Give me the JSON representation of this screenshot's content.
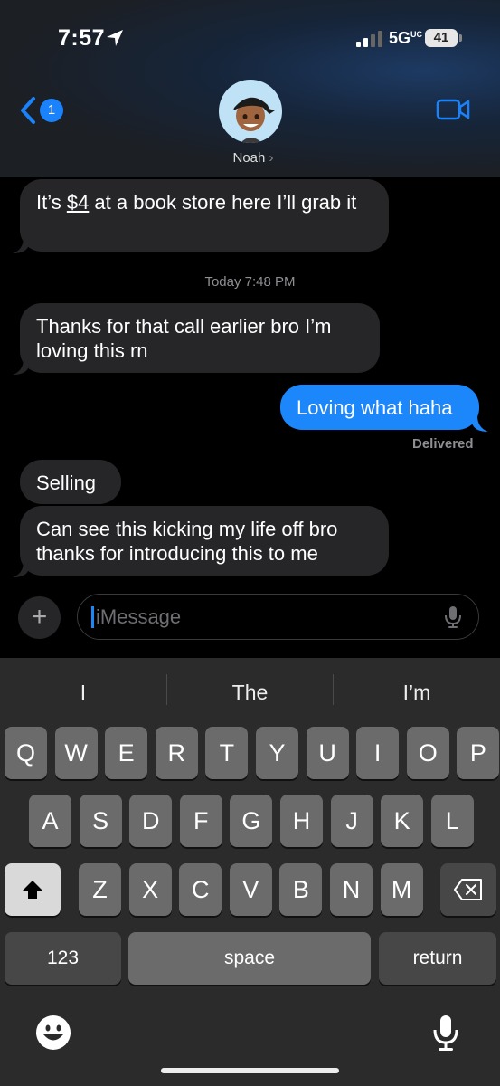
{
  "status_bar": {
    "time": "7:57",
    "network": "5G",
    "network_suffix": "UC",
    "battery": "41"
  },
  "header": {
    "back_badge": "1",
    "contact_name": "Noah",
    "name_chevron": "›"
  },
  "messages": [
    {
      "from": "them",
      "text_prefix": "It’s ",
      "text_link": "$4",
      "text_suffix": " at a book store here I’ll grab it"
    },
    {
      "from": "meta",
      "label": "Today",
      "time": "7:48 PM"
    },
    {
      "from": "them",
      "text": "Thanks for that call earlier bro I’m loving this rn"
    },
    {
      "from": "me",
      "text": "Loving what haha",
      "status": "Delivered"
    },
    {
      "from": "them",
      "text": "Selling"
    },
    {
      "from": "them",
      "text": "Can see this kicking my life off bro thanks for introducing this to me"
    }
  ],
  "composer": {
    "placeholder": "iMessage",
    "plus": "+"
  },
  "keyboard": {
    "suggestions": [
      "I",
      "The",
      "I’m"
    ],
    "row1": [
      "Q",
      "W",
      "E",
      "R",
      "T",
      "Y",
      "U",
      "I",
      "O",
      "P"
    ],
    "row2": [
      "A",
      "S",
      "D",
      "F",
      "G",
      "H",
      "J",
      "K",
      "L"
    ],
    "row3": [
      "Z",
      "X",
      "C",
      "V",
      "B",
      "N",
      "M"
    ],
    "numbers_key": "123",
    "space_key": "space",
    "return_key": "return"
  },
  "icons": [
    "location-arrow-icon",
    "signal-icon",
    "back-chevron-icon",
    "video-camera-icon",
    "plus-icon",
    "mic-icon",
    "shift-icon",
    "delete-icon",
    "emoji-icon",
    "dictation-icon"
  ],
  "colors": {
    "accent": "#1b87fb",
    "received_bubble": "#262629",
    "keyboard_bg": "#2b2b2b"
  }
}
